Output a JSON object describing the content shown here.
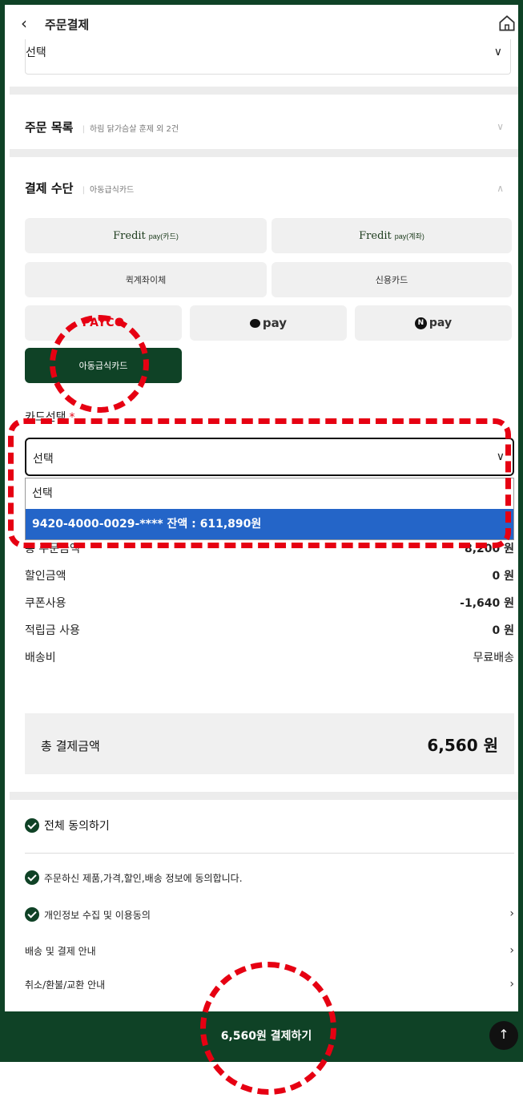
{
  "header": {
    "back_icon": "‹",
    "title": "주문결제"
  },
  "top_select": {
    "value": "선택"
  },
  "order_list": {
    "title": "주문 목록",
    "summary": "하림 닭가슴살 훈제 외 2건"
  },
  "payment": {
    "title": "결제 수단",
    "selected_summary": "아동급식카드",
    "methods": [
      {
        "brand": "Fredit",
        "suffix": "pay(카드)"
      },
      {
        "brand": "Fredit",
        "suffix": "pay(계좌)"
      },
      {
        "label": "퀵계좌이체"
      },
      {
        "label": "신용카드"
      },
      {
        "label": "PAYCO"
      },
      {
        "label": "pay"
      },
      {
        "label": "pay"
      },
      {
        "label": "아동급식카드"
      }
    ]
  },
  "card_select": {
    "label": "카드선택",
    "required_mark": "*",
    "value": "선택",
    "options": [
      "선택",
      "9420-4000-0029-**** 잔액 : 611,890원"
    ]
  },
  "summary": {
    "rows": [
      {
        "label": "총 주문금액",
        "value": "8,200 원"
      },
      {
        "label": "할인금액",
        "value": "0 원"
      },
      {
        "label": "쿠폰사용",
        "value": "-1,640 원"
      },
      {
        "label": "적립금 사용",
        "value": "0 원"
      },
      {
        "label": "배송비",
        "value": "무료배송"
      }
    ],
    "total_label": "총 결제금액",
    "total_value": "6,560 원"
  },
  "agreements": {
    "all": "전체 동의하기",
    "items": [
      {
        "label": "주문하신 제품,가격,할인,배송 정보에 동의합니다."
      },
      {
        "label": "개인정보 수집 및 이용동의"
      },
      {
        "label": "배송 및 결제 안내"
      },
      {
        "label": "취소/환불/교환 안내"
      }
    ]
  },
  "pay_button": {
    "label": "6,560원 결제하기"
  },
  "top_button": {
    "icon": "↑"
  },
  "colors": {
    "brand": "#0f4226",
    "accent_red": "#e60012",
    "dropdown_highlight": "#2465c8"
  }
}
